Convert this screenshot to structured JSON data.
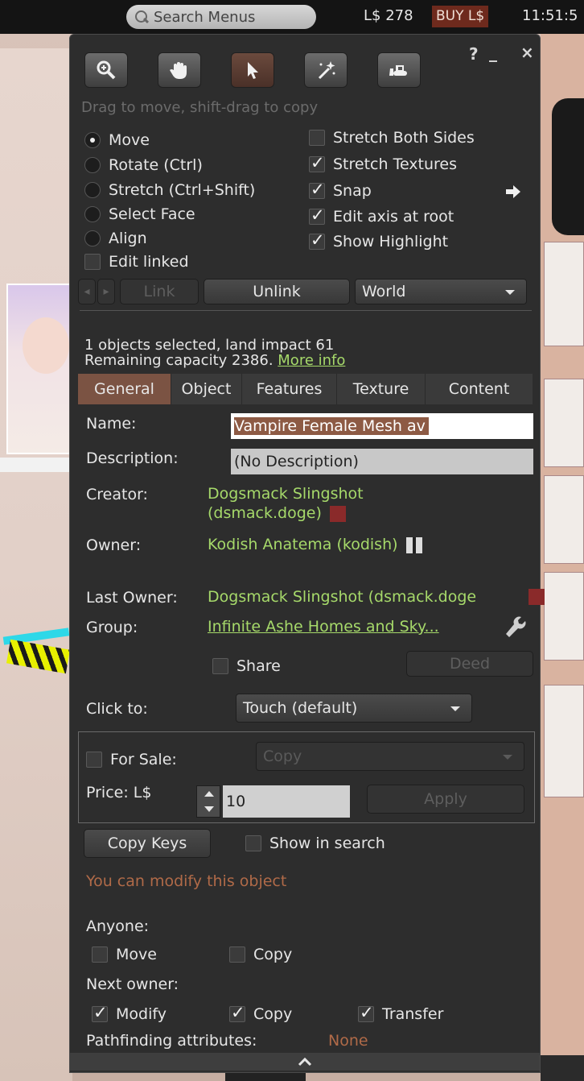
{
  "topbar": {
    "search_placeholder": "Search Menus",
    "balance": "L$ 278",
    "buy_label": "BUY L$",
    "time": "11:51:5"
  },
  "toolbar": {
    "buttons": [
      {
        "icon": "zoom-icon",
        "active": false
      },
      {
        "icon": "grab-hand-icon",
        "active": false
      },
      {
        "icon": "arrow-pointer-icon",
        "active": true
      },
      {
        "icon": "magic-wand-icon",
        "active": false
      },
      {
        "icon": "bulldozer-icon",
        "active": false
      }
    ],
    "help": "?",
    "minimize": "_",
    "close": "×",
    "hint": "Drag to move, shift-drag to copy"
  },
  "edit_modes": [
    {
      "label": "Move",
      "selected": true
    },
    {
      "label": "Rotate (Ctrl)",
      "selected": false
    },
    {
      "label": "Stretch (Ctrl+Shift)",
      "selected": false
    },
    {
      "label": "Select Face",
      "selected": false
    },
    {
      "label": "Align",
      "selected": false
    }
  ],
  "edit_linked": {
    "label": "Edit linked",
    "checked": false
  },
  "options": [
    {
      "label": "Stretch Both Sides",
      "checked": false
    },
    {
      "label": "Stretch Textures",
      "checked": true
    },
    {
      "label": "Snap",
      "checked": true
    },
    {
      "label": "Edit axis at root",
      "checked": true
    },
    {
      "label": "Show Highlight",
      "checked": true
    }
  ],
  "link_row": {
    "link": "Link",
    "unlink": "Unlink",
    "ruler": "World"
  },
  "selection": {
    "line1": "1 objects selected, land impact 61",
    "line2": "Remaining capacity 2386.",
    "more_info": "More info"
  },
  "tabs": [
    "General",
    "Object",
    "Features",
    "Texture",
    "Content"
  ],
  "general": {
    "name_label": "Name:",
    "name_value": "Vampire Female Mesh av",
    "description_label": "Description:",
    "description_value": "(No Description)",
    "creator_label": "Creator:",
    "creator_line1": "Dogsmack Slingshot",
    "creator_line2": "(dsmack.doge)",
    "owner_label": "Owner:",
    "owner_value": "Kodish Anatema (kodish)",
    "last_owner_label": "Last Owner:",
    "last_owner_value": "Dogsmack Slingshot (dsmack.doge",
    "group_label": "Group:",
    "group_value": "Infinite Ashe Homes and Sky...",
    "share_label": "Share",
    "deed_label": "Deed",
    "click_to_label": "Click to:",
    "click_to_value": "Touch  (default)",
    "for_sale_label": "For Sale:",
    "sale_type": "Copy",
    "price_label": "Price: L$",
    "price_value": "10",
    "apply_label": "Apply",
    "copy_keys_label": "Copy Keys",
    "show_in_search_label": "Show in search",
    "modify_notice": "You can modify this object",
    "anyone_label": "Anyone:",
    "anyone_move": "Move",
    "anyone_copy": "Copy",
    "next_owner_label": "Next owner:",
    "next_modify": "Modify",
    "next_copy": "Copy",
    "next_transfer": "Transfer",
    "pathfinding_label": "Pathfinding attributes:",
    "pathfinding_value": "None"
  },
  "colors": {
    "accent_tab": "#7b5343",
    "link_green": "#a6d96a",
    "notice_orange": "#b06a48",
    "panel_bg": "#2d2d2d"
  }
}
